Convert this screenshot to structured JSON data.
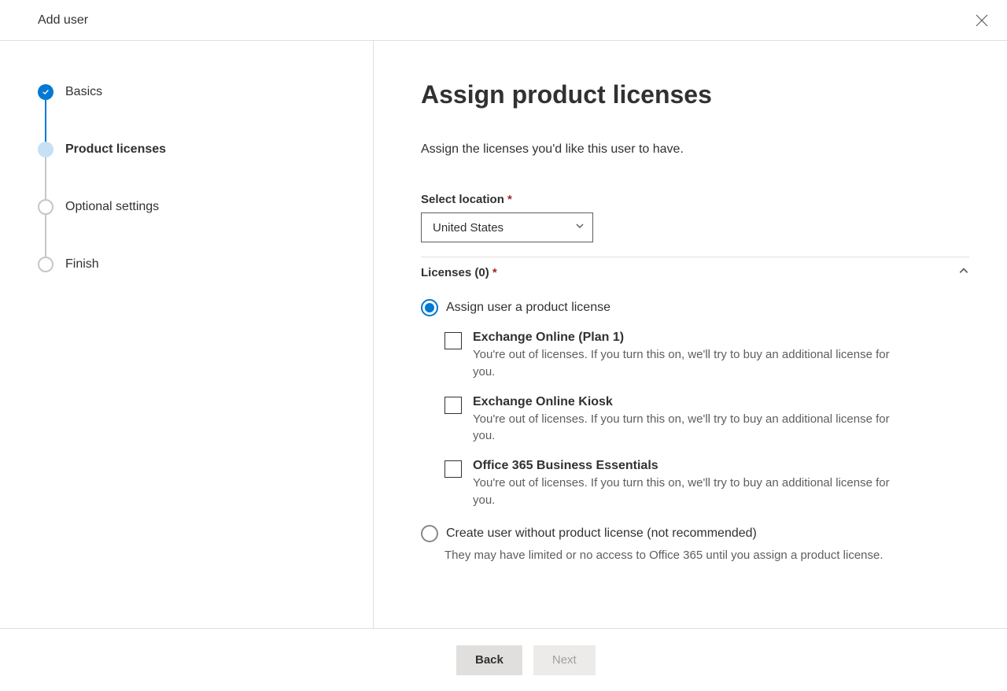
{
  "header": {
    "title": "Add user"
  },
  "wizard": {
    "steps": [
      {
        "label": "Basics"
      },
      {
        "label": "Product licenses"
      },
      {
        "label": "Optional settings"
      },
      {
        "label": "Finish"
      }
    ]
  },
  "page": {
    "title": "Assign product licenses",
    "description": "Assign the licenses you'd like this user to have."
  },
  "location": {
    "label": "Select location",
    "value": "United States"
  },
  "licenses": {
    "section_label": "Licenses (0)",
    "radio_assign": "Assign user a product license",
    "radio_none": "Create user without product license (not recommended)",
    "radio_none_desc": "They may have limited or no access to Office 365 until you assign a product license.",
    "items": [
      {
        "name": "Exchange Online (Plan 1)",
        "desc": "You're out of licenses. If you turn this on, we'll try to buy an additional license for you."
      },
      {
        "name": "Exchange Online Kiosk",
        "desc": "You're out of licenses. If you turn this on, we'll try to buy an additional license for you."
      },
      {
        "name": "Office 365 Business Essentials",
        "desc": "You're out of licenses. If you turn this on, we'll try to buy an additional license for you."
      }
    ]
  },
  "footer": {
    "back": "Back",
    "next": "Next"
  },
  "required_mark": "*"
}
